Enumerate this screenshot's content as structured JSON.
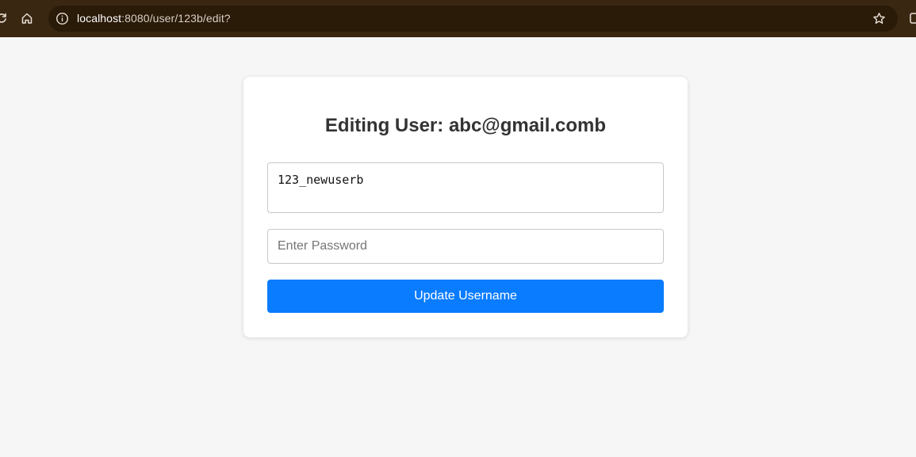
{
  "browser": {
    "url_host": "localhost",
    "url_rest": ":8080/user/123b/edit?"
  },
  "form": {
    "title_prefix": "Editing User: ",
    "email": "abc@gmail.comb",
    "username_value": "123_newuserb",
    "password_placeholder": "Enter Password",
    "submit_label": "Update Username",
    "button_color": "#0a7cff"
  }
}
